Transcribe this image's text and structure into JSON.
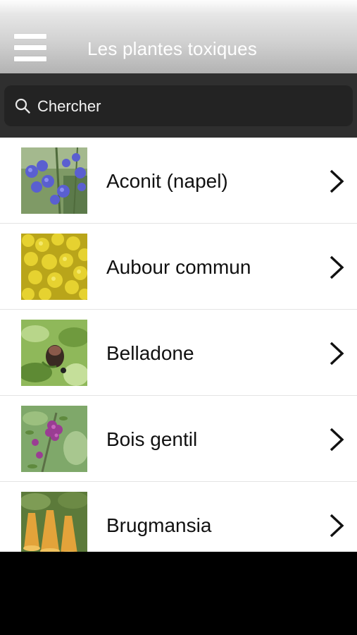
{
  "header": {
    "title": "Les plantes toxiques",
    "menu_icon": "hamburger-menu-icon"
  },
  "search": {
    "placeholder": "Chercher",
    "icon": "search-icon"
  },
  "colors": {
    "header_gradient_top": "#fdfdfd",
    "header_gradient_bottom": "#b3b3b3",
    "search_bar_bg": "#2f2f2f",
    "search_field_bg": "#232323",
    "list_bg": "#ffffff",
    "text_dark": "#111111"
  },
  "plants": [
    {
      "name": "Aconit (napel)",
      "thumbnail": "purple-blue flowers"
    },
    {
      "name": "Aubour commun",
      "thumbnail": "yellow flowers"
    },
    {
      "name": "Belladone",
      "thumbnail": "dark bell flower with berries"
    },
    {
      "name": "Bois gentil",
      "thumbnail": "pink-purple flowers"
    },
    {
      "name": "Brugmansia",
      "thumbnail": "orange trumpet flowers"
    }
  ]
}
